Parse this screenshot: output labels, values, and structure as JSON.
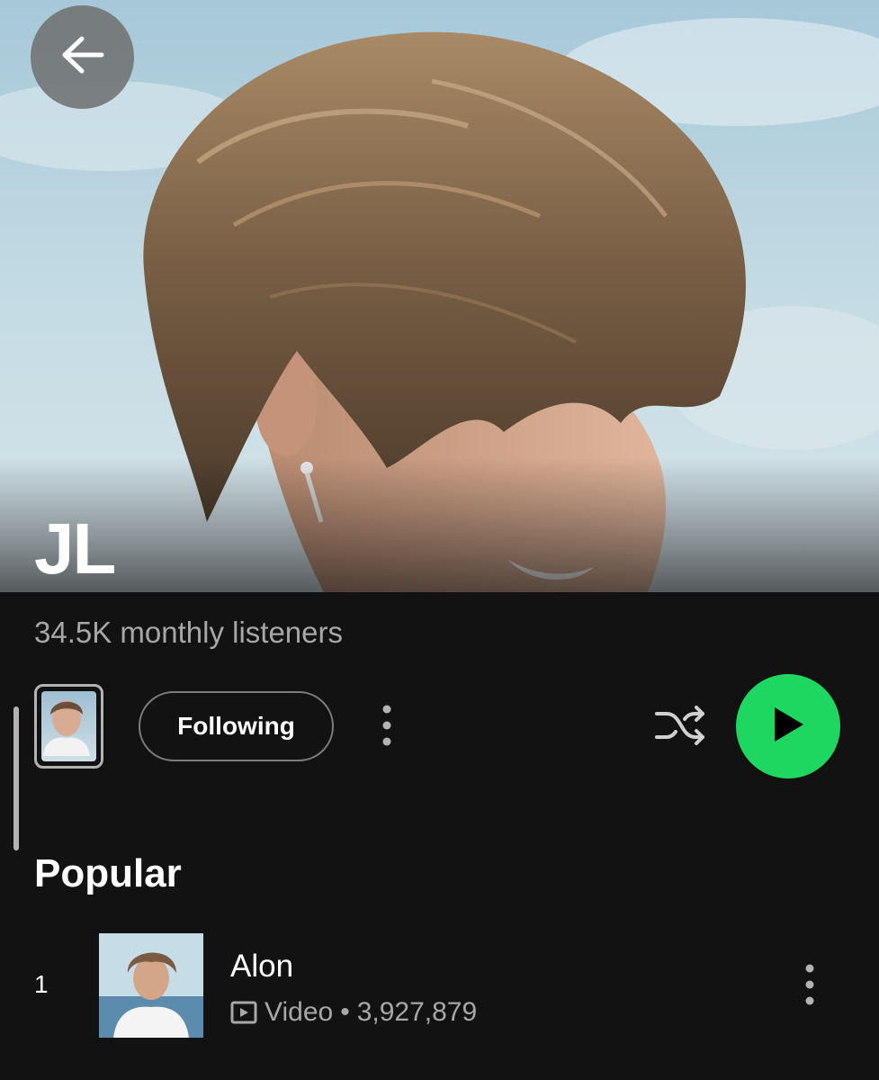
{
  "artist": {
    "name": "JL",
    "monthly_listeners": "34.5K monthly listeners"
  },
  "actions": {
    "follow_label": "Following"
  },
  "popular": {
    "title": "Popular",
    "tracks": [
      {
        "number": "1",
        "title": "Alon",
        "type": "Video",
        "separator": "•",
        "plays": "3,927,879"
      }
    ]
  },
  "colors": {
    "background": "#121212",
    "accent_green": "#1ed760",
    "secondary_text": "#a7a7a7",
    "back_button": "#6e6e6e"
  },
  "icons": {
    "back": "arrow-left-icon",
    "more": "more-vertical-icon",
    "shuffle": "shuffle-icon",
    "play": "play-icon",
    "video": "video-icon"
  }
}
